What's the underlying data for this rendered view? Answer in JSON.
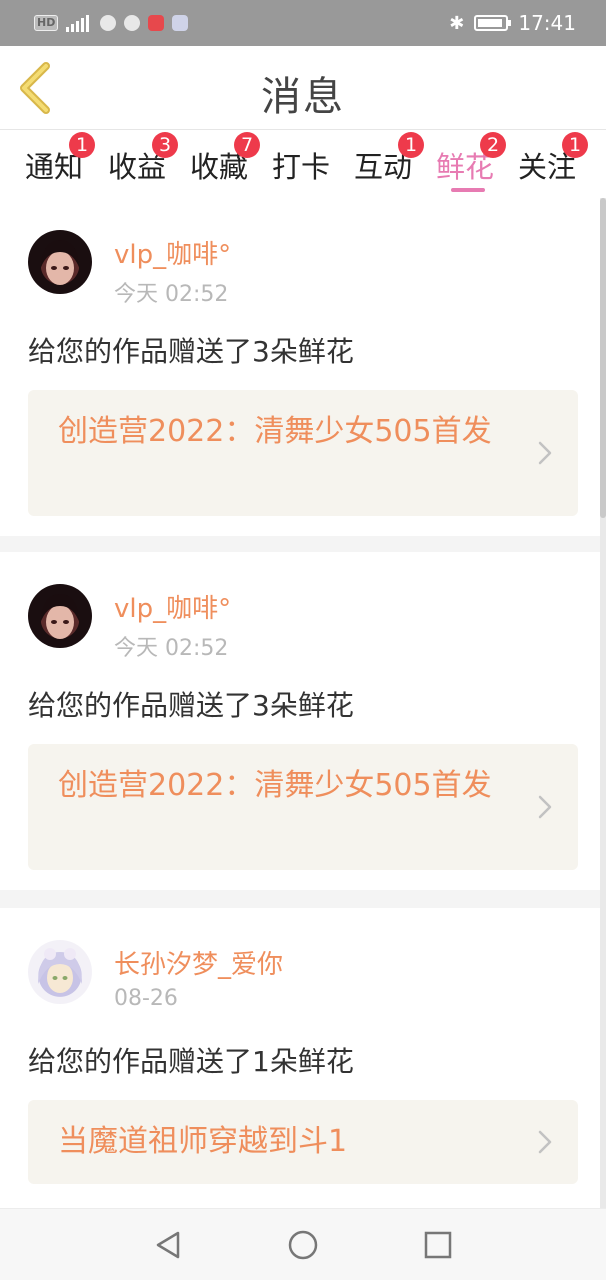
{
  "status_bar": {
    "hd_label": "HD",
    "time": "17:41"
  },
  "header": {
    "title": "消息",
    "back_icon": "chevron-left-icon"
  },
  "tabs": [
    {
      "label": "通知",
      "badge": "1"
    },
    {
      "label": "收益",
      "badge": "3"
    },
    {
      "label": "收藏",
      "badge": "7"
    },
    {
      "label": "打卡",
      "badge": ""
    },
    {
      "label": "互动",
      "badge": "1"
    },
    {
      "label": "鲜花",
      "badge": "2",
      "active": true
    },
    {
      "label": "关注",
      "badge": "1"
    }
  ],
  "colors": {
    "accent_pink": "#e77bb2",
    "username_orange": "#ef8e5c",
    "badge_red": "#ee3a4b"
  },
  "messages": [
    {
      "username": "vlp_咖啡°",
      "time": "今天 02:52",
      "text": "给您的作品赠送了3朵鲜花",
      "work_title": "创造营2022：清舞少女505首发"
    },
    {
      "username": "vlp_咖啡°",
      "time": "今天 02:52",
      "text": "给您的作品赠送了3朵鲜花",
      "work_title": "创造营2022：清舞少女505首发"
    },
    {
      "username": "长孙汐梦_爱你",
      "time": "08-26",
      "text": "给您的作品赠送了1朵鲜花",
      "work_title": "当魔道祖师穿越到斗1"
    }
  ]
}
